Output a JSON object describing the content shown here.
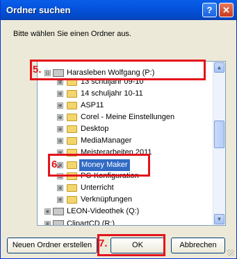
{
  "window": {
    "title": "Ordner suchen"
  },
  "titlebar": {
    "help_label": "?",
    "close_label": "✕"
  },
  "instruction": "Bitte wählen Sie einen Ordner aus.",
  "tree": {
    "items": [
      {
        "label": "Harasleben Wolfgang (P:)",
        "type": "drive",
        "expander": "⊟",
        "selected": false
      },
      {
        "label": "13 schuljahr 09-10",
        "type": "folder",
        "expander": "⊞",
        "selected": false
      },
      {
        "label": "14 schuljahr 10-11",
        "type": "folder",
        "expander": "⊞",
        "selected": false
      },
      {
        "label": "ASP11",
        "type": "folder",
        "expander": "⊞",
        "selected": false
      },
      {
        "label": "Corel - Meine Einstellungen",
        "type": "folder",
        "expander": "⊞",
        "selected": false
      },
      {
        "label": "Desktop",
        "type": "folder",
        "expander": "⊞",
        "selected": false
      },
      {
        "label": "MediaManager",
        "type": "folder",
        "expander": "⊞",
        "selected": false
      },
      {
        "label": "Meisterarbeiten 2011",
        "type": "folder",
        "expander": "⊞",
        "selected": false
      },
      {
        "label": "Money Maker",
        "type": "folder",
        "expander": "⊞",
        "selected": true
      },
      {
        "label": "PC-Konfiguration",
        "type": "folder",
        "expander": "⊞",
        "selected": false
      },
      {
        "label": "Unterricht",
        "type": "folder",
        "expander": "⊞",
        "selected": false
      },
      {
        "label": "Verknüpfungen",
        "type": "folder",
        "expander": "⊞",
        "selected": false
      },
      {
        "label": "LEON-Videothek (Q:)",
        "type": "drive",
        "expander": "⊞",
        "selected": false
      },
      {
        "label": "ClipartCD (R:)",
        "type": "drive",
        "expander": "⊞",
        "selected": false
      }
    ]
  },
  "buttons": {
    "new_folder": "Neuen Ordner erstellen",
    "ok": "OK",
    "cancel": "Abbrechen"
  },
  "markers": {
    "m5": "5.",
    "m6": "6.",
    "m7": "7."
  },
  "colors": {
    "marker": "#e3141b",
    "selection": "#316ac5",
    "titlebar": "#0453dd"
  }
}
